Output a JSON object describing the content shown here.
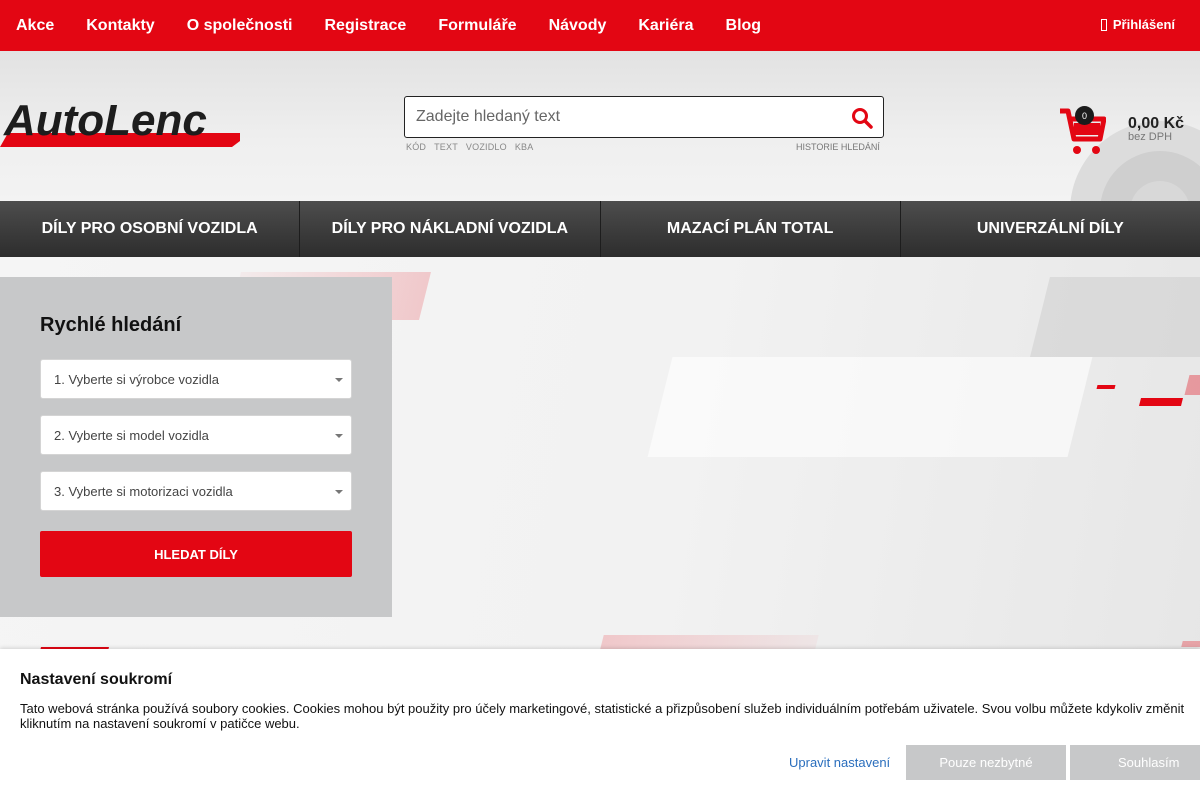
{
  "top_nav": {
    "items": [
      "Akce",
      "Kontakty",
      "O společnosti",
      "Registrace",
      "Formuláře",
      "Návody",
      "Kariéra",
      "Blog"
    ],
    "login": "Přihlášení"
  },
  "header": {
    "logo_text": "AutoLenc",
    "search": {
      "placeholder": "Zadejte hledaný text",
      "modes": [
        "KÓD",
        "TEXT",
        "VOZIDLO",
        "KBA"
      ],
      "history": "HISTORIE HLEDÁNÍ"
    },
    "cart": {
      "count": "0",
      "price": "0,00 Kč",
      "vat_note": "bez DPH"
    }
  },
  "categories": [
    "DÍLY PRO OSOBNÍ VOZIDLA",
    "DÍLY PRO NÁKLADNÍ VOZIDLA",
    "MAZACÍ PLÁN TOTAL",
    "UNIVERZÁLNÍ DÍLY"
  ],
  "quick_search": {
    "title": "Rychlé hledání",
    "selects": [
      "1. Vyberte si výrobce vozidla",
      "2. Vyberte si model vozidla",
      "3. Vyberte si motorizaci vozidla"
    ],
    "button": "HLEDAT DÍLY"
  },
  "cookie_banner": {
    "title": "Nastavení soukromí",
    "text_line1": "Tato webová stránka používá soubory cookies. Cookies mohou být použity pro účely marketingové, statistické a přizpůsobení služeb individuálním potřebám uživatele. Svou volbu můžete kdykoliv změnit",
    "text_line2": "kliknutím na nastavení soukromí v patičce webu.",
    "link": "Upravit nastavení",
    "button_necessary": "Pouze nezbytné",
    "button_accept": "Souhlasím"
  },
  "colors": {
    "brand_red": "#e30613",
    "category_bar": "#3a3a3a",
    "panel_gray": "#c7c8c9"
  }
}
